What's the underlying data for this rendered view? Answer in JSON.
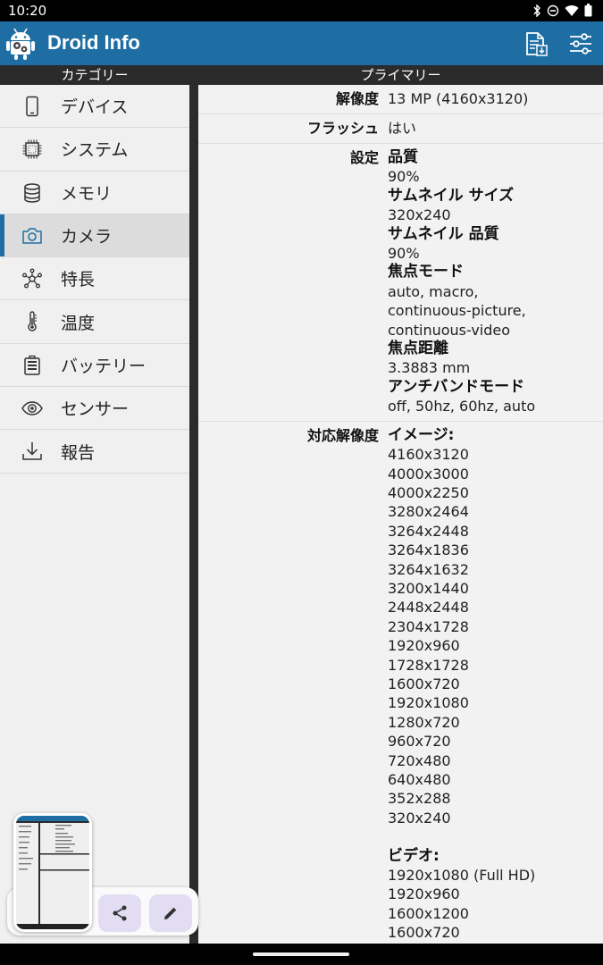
{
  "status_bar": {
    "time": "10:20"
  },
  "app": {
    "title": "Droid Info"
  },
  "headers": {
    "left": "カテゴリー",
    "right": "プライマリー"
  },
  "sidebar": {
    "items": [
      {
        "label": "デバイス",
        "icon": "phone-icon"
      },
      {
        "label": "システム",
        "icon": "chip-icon"
      },
      {
        "label": "メモリ",
        "icon": "database-icon"
      },
      {
        "label": "カメラ",
        "icon": "camera-icon",
        "active": true
      },
      {
        "label": "特長",
        "icon": "network-icon"
      },
      {
        "label": "温度",
        "icon": "thermometer-icon"
      },
      {
        "label": "バッテリー",
        "icon": "battery-icon"
      },
      {
        "label": "センサー",
        "icon": "eye-icon"
      },
      {
        "label": "報告",
        "icon": "download-icon"
      }
    ]
  },
  "details": {
    "resolution": {
      "key": "解像度",
      "value": "13 MP (4160x3120)"
    },
    "flash": {
      "key": "フラッシュ",
      "value": "はい"
    },
    "settings": {
      "key": "設定",
      "quality_label": "品質",
      "quality": "90%",
      "thumb_size_label": "サムネイル サイズ",
      "thumb_size": "320x240",
      "thumb_quality_label": "サムネイル 品質",
      "thumb_quality": "90%",
      "focus_mode_label": "焦点モード",
      "focus_mode_1": "auto, macro,",
      "focus_mode_2": "continuous-picture,",
      "focus_mode_3": "continuous-video",
      "focal_length_label": "焦点距離",
      "focal_length": "3.3883 mm",
      "antibanding_label": "アンチバンドモード",
      "antibanding": "off, 50hz, 60hz, auto"
    },
    "supported": {
      "key": "対応解像度",
      "image_label": "イメージ:",
      "images": [
        "4160x3120",
        "4000x3000",
        "4000x2250",
        "3280x2464",
        "3264x2448",
        "3264x1836",
        "3264x1632",
        "3200x1440",
        "2448x2448",
        "2304x1728",
        "1920x960",
        "1728x1728",
        "1600x720",
        "1920x1080",
        "1280x720",
        "960x720",
        "720x480",
        "640x480",
        "352x288",
        "320x240"
      ],
      "video_label": "ビデオ:",
      "videos": [
        "1920x1080 (Full HD)",
        "1920x960",
        "1600x1200",
        "1600x720"
      ]
    }
  }
}
